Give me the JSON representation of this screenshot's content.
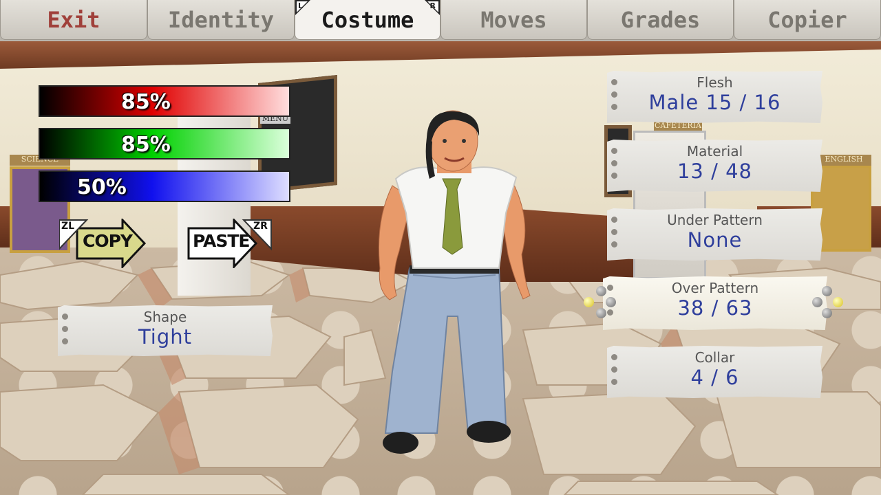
{
  "tabs": [
    {
      "label": "Exit"
    },
    {
      "label": "Identity"
    },
    {
      "label": "Costume",
      "left_button": "L",
      "right_button": "R"
    },
    {
      "label": "Moves"
    },
    {
      "label": "Grades"
    },
    {
      "label": "Copier"
    }
  ],
  "active_tab": "Costume",
  "color_bars": {
    "red": {
      "label": "85%",
      "value": 85,
      "color": "#e00000"
    },
    "green": {
      "label": "85%",
      "value": 85,
      "color": "#00d000"
    },
    "blue": {
      "label": "50%",
      "value": 50,
      "color": "#1010ee"
    }
  },
  "copy": {
    "label": "COPY",
    "button": "ZL",
    "color": "#d8d88a"
  },
  "paste": {
    "label": "PASTE",
    "button": "ZR",
    "color": "#ffffff"
  },
  "shape": {
    "title": "Shape",
    "value": "Tight"
  },
  "options": [
    {
      "title": "Flesh",
      "value": "Male 15 / 16"
    },
    {
      "title": "Material",
      "value": "13 / 48"
    },
    {
      "title": "Under Pattern",
      "value": "None"
    },
    {
      "title": "Over Pattern",
      "value": "38 / 63"
    },
    {
      "title": "Collar",
      "value": "4 / 6"
    }
  ],
  "selected_option": "Over Pattern",
  "scene_signs": {
    "science": "SCIENCE",
    "english": "ENGLISH",
    "cafeteria": "CAFETERIA",
    "menu": "MENU"
  },
  "colors": {
    "text_value": "#2f3f9c",
    "exit_tab": "#a0403a",
    "card_bg": "#e4e2dd"
  }
}
